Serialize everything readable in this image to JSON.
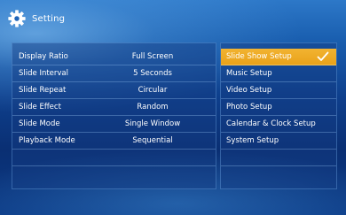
{
  "header": {
    "title": "Setting",
    "icon": "gear-icon"
  },
  "settings": [
    {
      "label": "Display Ratio",
      "value": "Full Screen"
    },
    {
      "label": "Slide Interval",
      "value": "5 Seconds"
    },
    {
      "label": "Slide Repeat",
      "value": "Circular"
    },
    {
      "label": "Slide Effect",
      "value": "Random"
    },
    {
      "label": "Slide Mode",
      "value": "Single Window"
    },
    {
      "label": "Playback Mode",
      "value": "Sequential"
    }
  ],
  "menu": {
    "items": [
      {
        "label": "Slide Show Setup",
        "selected": true
      },
      {
        "label": "Music Setup",
        "selected": false
      },
      {
        "label": "Video Setup",
        "selected": false
      },
      {
        "label": "Photo Setup",
        "selected": false
      },
      {
        "label": "Calendar & Clock Setup",
        "selected": false
      },
      {
        "label": "System Setup",
        "selected": false
      }
    ],
    "selected_icon": "checkmark-icon"
  },
  "colors": {
    "accent": "#eca823",
    "background": "#0e3f8c"
  }
}
